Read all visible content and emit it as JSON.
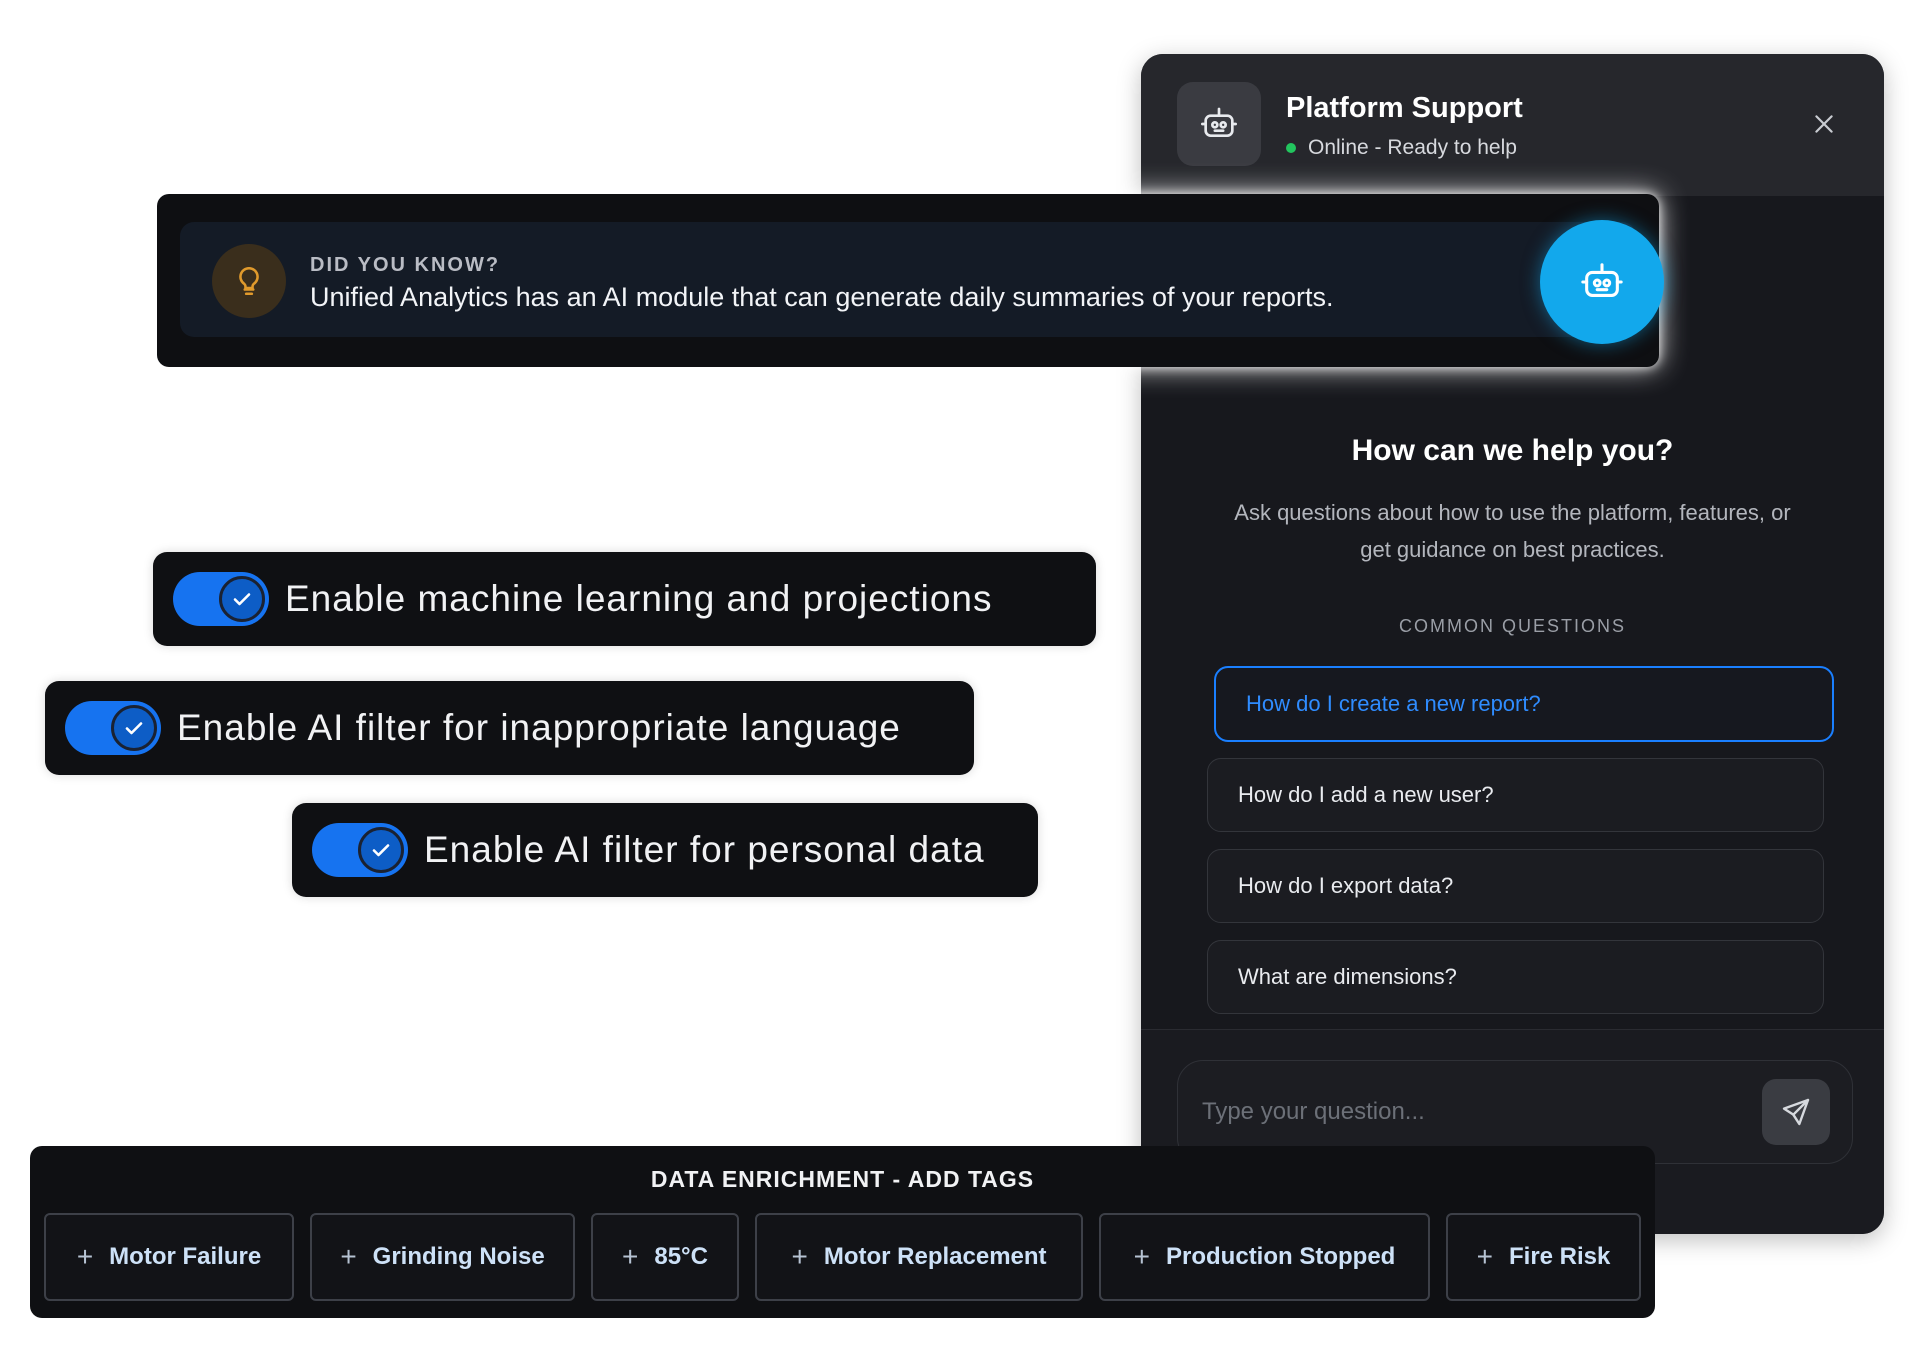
{
  "chat": {
    "title": "Platform Support",
    "status": "Online - Ready to help",
    "heading": "How can we help you?",
    "description": "Ask questions about how to use the platform, features, or get guidance on best practices.",
    "common_label": "COMMON QUESTIONS",
    "questions": [
      {
        "label": "How do I create a new report?",
        "active": true
      },
      {
        "label": "How do I add a new user?",
        "active": false
      },
      {
        "label": "How do I export data?",
        "active": false
      },
      {
        "label": "What are dimensions?",
        "active": false
      }
    ],
    "input_placeholder": "Type your question...",
    "icons": {
      "avatar": "robot-icon",
      "close": "close-icon",
      "send": "send-icon"
    }
  },
  "tip": {
    "label": "DID YOU KNOW?",
    "text": "Unified Analytics has an AI module that can generate daily summaries of your reports.",
    "icons": {
      "tip": "lightbulb-icon",
      "assistant": "robot-icon"
    }
  },
  "toggles": [
    {
      "label": "Enable machine learning and projections",
      "enabled": true
    },
    {
      "label": "Enable AI filter for inappropriate language",
      "enabled": true
    },
    {
      "label": "Enable AI filter for personal data",
      "enabled": true
    }
  ],
  "tags": {
    "title": "DATA ENRICHMENT - ADD TAGS",
    "items": [
      "Motor Failure",
      "Grinding Noise",
      "85°C",
      "Motor Replacement",
      "Production Stopped",
      "Fire Risk"
    ]
  },
  "colors": {
    "accent": "#1673f0",
    "assistant": "#12a8ec",
    "online": "#22c55e",
    "panel": "#17181d"
  }
}
